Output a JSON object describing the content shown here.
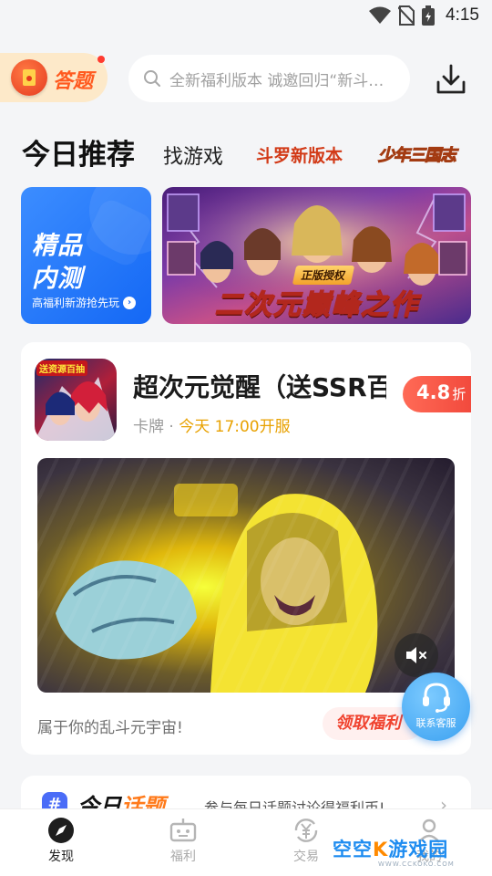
{
  "status_bar": {
    "time": "4:15"
  },
  "header": {
    "quiz_label": "答题",
    "search_placeholder": "全新福利版本 诚邀回归“新斗罗大陆”"
  },
  "tabs": {
    "active": "今日推荐",
    "find_games": "找游戏",
    "douluo": "斗罗新版本",
    "shaonian": "少年三国志"
  },
  "banners": {
    "left": {
      "line1": "精品",
      "line2": "内测",
      "subtitle": "高福利新游抢先玩"
    },
    "right": {
      "tag": "正版授权",
      "title": "二次元巅峰之作"
    }
  },
  "game_card": {
    "icon_badge": "送资源百抽",
    "title": "超次元觉醒（送SSR百抽）",
    "category": "卡牌",
    "separator": "·",
    "open_time": "今天 17:00开服",
    "discount_value": "4.8",
    "discount_unit": "折",
    "tagline": "属于你的乱斗元宇宙!",
    "claim_button": "领取福利"
  },
  "support": {
    "label": "联系客服"
  },
  "topic": {
    "hash": "#",
    "title_a": "今日",
    "title_b": "话题",
    "description": "参与每日话题讨论得福利币!"
  },
  "bottom_nav": {
    "items": [
      {
        "label": "发现",
        "icon": "compass-icon",
        "active": true
      },
      {
        "label": "福利",
        "icon": "gift-robot-icon",
        "active": false
      },
      {
        "label": "交易",
        "icon": "trade-yen-icon",
        "active": false
      },
      {
        "label": "我的",
        "icon": "user-icon",
        "active": false
      }
    ]
  },
  "watermark": {
    "text_a": "空空",
    "text_k": "K",
    "text_b": "游戏园",
    "url": "WWW.CCKOKO.COM"
  },
  "colors": {
    "accent_blue": "#1468f5",
    "discount_red": "#f24a3d",
    "time_orange": "#e8a100",
    "claim_red": "#f0432f"
  }
}
